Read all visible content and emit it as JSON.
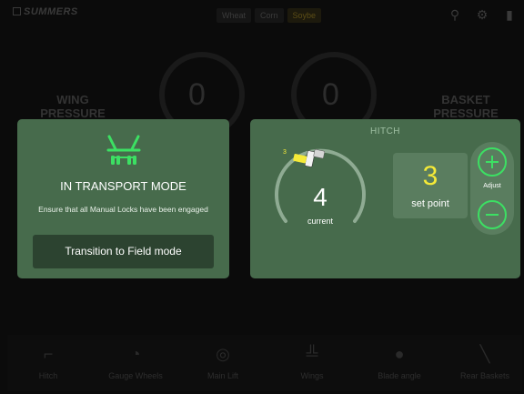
{
  "header": {
    "brand": "SUMMERS",
    "crop_tabs": [
      {
        "label": "Wheat",
        "active": false
      },
      {
        "label": "Corn",
        "active": false
      },
      {
        "label": "Soybe",
        "active": true
      }
    ],
    "icons": [
      "implement-icon",
      "gear-icon",
      "fuel-icon"
    ]
  },
  "background": {
    "wing_pressure": {
      "label_line1": "WING",
      "label_line2": "PRESSURE",
      "value": "0"
    },
    "basket_pressure": {
      "label_line1": "BASKET",
      "label_line2": "PRESSURE",
      "value": "0"
    }
  },
  "transport_panel": {
    "title": "IN TRANSPORT MODE",
    "message": "Ensure that all Manual Locks have been engaged",
    "button_label": "Transition to Field mode",
    "icon": "transport-implement-icon",
    "icon_color": "#3ce063"
  },
  "hitch_panel": {
    "title": "HITCH",
    "current_value": "4",
    "current_label": "current",
    "marker_value": "3",
    "set_point_value": "3",
    "set_point_label": "set point",
    "adjust_label": "Adjust",
    "accent_color": "#3ce063",
    "setpoint_color": "#f5ea38"
  },
  "bottom_tray": [
    {
      "label": "Hitch",
      "icon": "hitch-icon"
    },
    {
      "label": "Gauge Wheels",
      "icon": "gauge-wheel-icon"
    },
    {
      "label": "Main Lift",
      "icon": "main-lift-icon"
    },
    {
      "label": "Wings",
      "icon": "wings-icon"
    },
    {
      "label": "Blade angle",
      "icon": "blade-angle-icon"
    },
    {
      "label": "Rear Baskets",
      "icon": "rear-baskets-icon"
    }
  ]
}
